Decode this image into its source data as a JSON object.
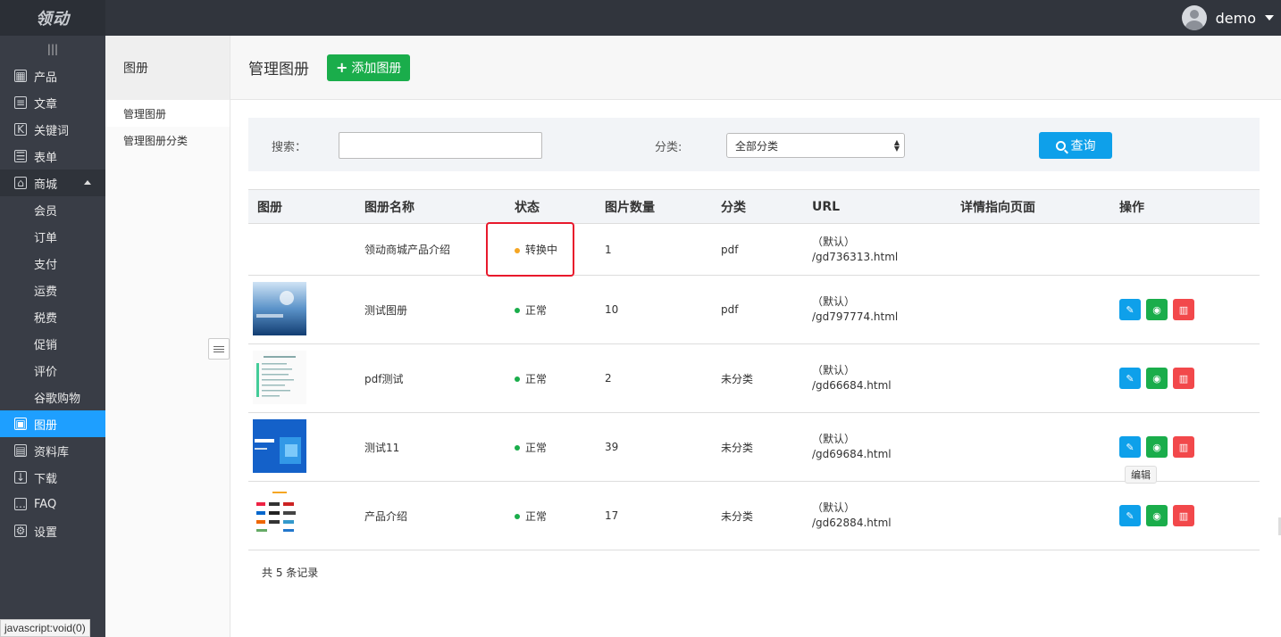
{
  "app": {
    "logo_text": "领动"
  },
  "user": {
    "name": "demo"
  },
  "sidebar": {
    "collapse_glyph": "|||",
    "items": [
      {
        "label": "产品",
        "icon": "grid-icon",
        "glyph": "▦"
      },
      {
        "label": "文章",
        "icon": "article-icon",
        "glyph": "≡"
      },
      {
        "label": "关键词",
        "icon": "keyword-icon",
        "glyph": "K"
      },
      {
        "label": "表单",
        "icon": "form-icon",
        "glyph": "☰"
      },
      {
        "label": "商城",
        "icon": "shop-icon",
        "glyph": "⌂"
      },
      {
        "label": "会员"
      },
      {
        "label": "订单"
      },
      {
        "label": "支付"
      },
      {
        "label": "运费"
      },
      {
        "label": "税费"
      },
      {
        "label": "促销"
      },
      {
        "label": "评价"
      },
      {
        "label": "谷歌购物"
      },
      {
        "label": "图册",
        "icon": "album-icon",
        "glyph": "▣"
      },
      {
        "label": "资料库",
        "icon": "library-icon",
        "glyph": "▤"
      },
      {
        "label": "下载",
        "icon": "download-icon",
        "glyph": "↓"
      },
      {
        "label": "FAQ",
        "icon": "faq-icon",
        "glyph": "…"
      },
      {
        "label": "设置",
        "icon": "settings-icon",
        "glyph": "⚙"
      }
    ]
  },
  "subpanel": {
    "title": "图册",
    "links": [
      "管理图册",
      "管理图册分类"
    ]
  },
  "header": {
    "title": "管理图册",
    "add_label": "添加图册"
  },
  "search": {
    "label": "搜索：",
    "category_label": "分类:",
    "category_value": "全部分类",
    "query_label": "查询"
  },
  "table": {
    "columns": [
      "图册",
      "图册名称",
      "状态",
      "图片数量",
      "分类",
      "URL",
      "详情指向页面",
      "操作"
    ],
    "rows": [
      {
        "name": "领动商城产品介绍",
        "status": "转换中",
        "status_color": "#f5a623",
        "count": "1",
        "category": "pdf",
        "url_default": "（默认）",
        "url_path": "/gd736313.html",
        "has_thumb": false,
        "has_ops": false
      },
      {
        "name": "测试图册",
        "status": "正常",
        "status_color": "#1aad4b",
        "count": "10",
        "category": "pdf",
        "url_default": "（默认）",
        "url_path": "/gd797774.html",
        "has_thumb": true,
        "has_ops": true
      },
      {
        "name": "pdf测试",
        "status": "正常",
        "status_color": "#1aad4b",
        "count": "2",
        "category": "未分类",
        "url_default": "（默认）",
        "url_path": "/gd66684.html",
        "has_thumb": true,
        "has_ops": true
      },
      {
        "name": "测试11",
        "status": "正常",
        "status_color": "#1aad4b",
        "count": "39",
        "category": "未分类",
        "url_default": "（默认）",
        "url_path": "/gd69684.html",
        "has_thumb": true,
        "has_ops": true
      },
      {
        "name": "产品介绍",
        "status": "正常",
        "status_color": "#1aad4b",
        "count": "17",
        "category": "未分类",
        "url_default": "（默认）",
        "url_path": "/gd62884.html",
        "has_thumb": true,
        "has_ops": true
      }
    ],
    "total": "共 5 条记录"
  },
  "tooltip": "编辑",
  "status_bar": "javascript:void(0)",
  "colors": {
    "accent": "#1e9fff",
    "add_button": "#1aad4b",
    "query_button": "#0ea0ea",
    "delete_button": "#f2484b",
    "highlight": "#e8192c"
  }
}
